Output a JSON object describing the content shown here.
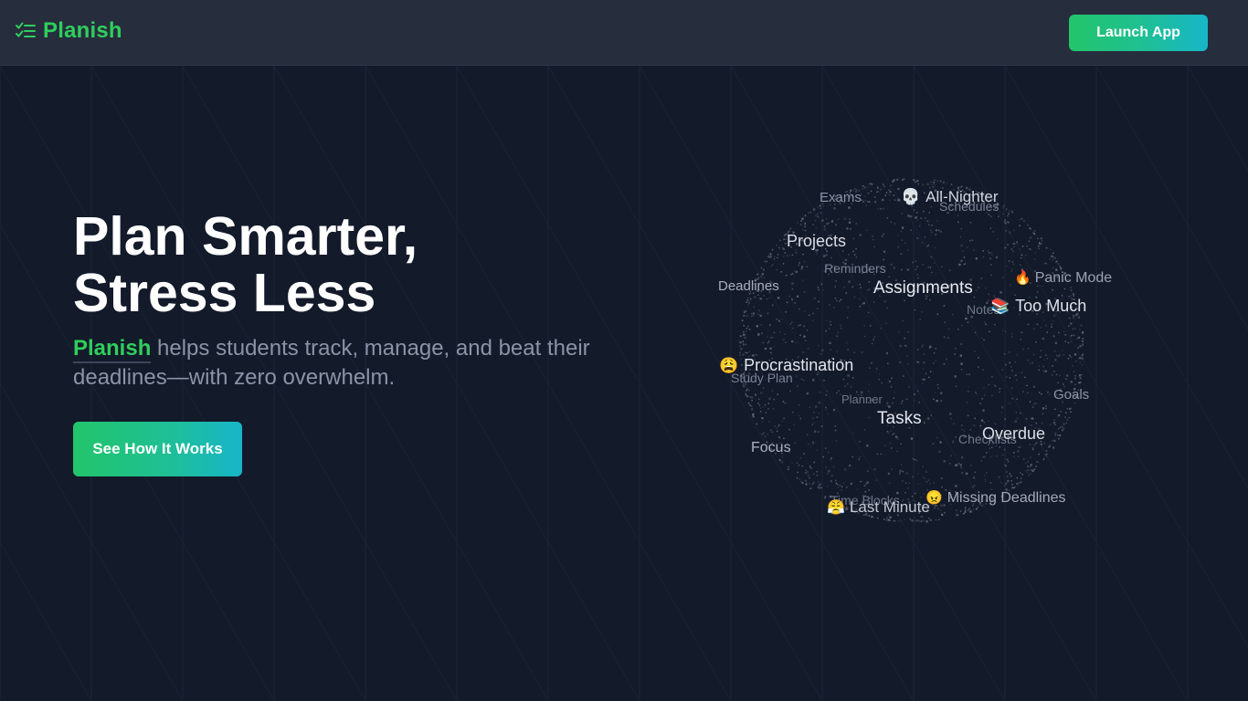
{
  "navbar": {
    "brand": "Planish",
    "launch_label": "Launch App"
  },
  "hero": {
    "title_line1": "Plan Smarter,",
    "title_line2": "Stress Less",
    "subtitle_brand": "Planish",
    "subtitle_rest": " helps students track, manage, and beat their deadlines—with zero overwhelm.",
    "cta_label": "See How It Works"
  },
  "sphere": {
    "labels": {
      "exams": "Exams",
      "all_nighter": "All-Nighter",
      "schedules": "Schedules",
      "projects": "Projects",
      "reminders": "Reminders",
      "deadlines": "Deadlines",
      "assignments": "Assignments",
      "panic_mode": "Panic Mode",
      "notes": "Notes",
      "too_much": "Too Much",
      "procrastination": "Procrastination",
      "study_plan": "Study Plan",
      "planner": "Planner",
      "goals": "Goals",
      "tasks": "Tasks",
      "overdue": "Overdue",
      "checklists": "Checklists",
      "focus": "Focus",
      "time_blocks": "Time Blocks",
      "missing_deadlines": "Missing Deadlines",
      "last_minute": "Last Minute"
    },
    "emojis": {
      "all_nighter": "💀",
      "panic_mode": "🔥",
      "too_much": "📚",
      "procrastination": "😩",
      "missing_deadlines": "😠",
      "last_minute": "😤"
    }
  },
  "colors": {
    "background": "#131a2a",
    "navbar": "#262d3d",
    "brand_green": "#2fce5b",
    "gradient_start": "#22c56a",
    "gradient_end": "#17b6c9",
    "subtitle": "#8b93a6"
  },
  "icons": {
    "logo": "checklist-icon"
  }
}
